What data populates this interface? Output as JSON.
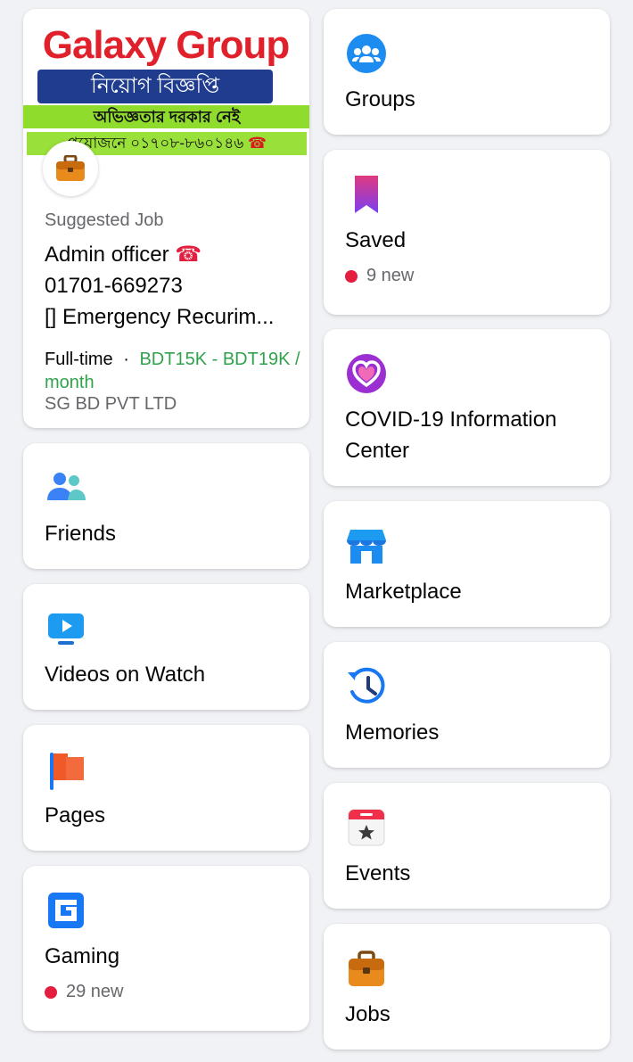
{
  "job_card": {
    "banner": {
      "title": "Galaxy Group",
      "line1": "নিয়োগ বিজ্ঞপ্তি",
      "line2": "অভিজ্ঞতার দরকার নেই",
      "line3": "প্রয়োজনে ০১৭০৮-৮৬০১৪৬",
      "line3_icon": "☎"
    },
    "avatar_icon": "briefcase-icon",
    "subtitle": "Suggested Job",
    "title_line1": "Admin officer",
    "title_icon": "☎",
    "title_line2": "01701-669273",
    "title_line3": "[] Emergency Recurim...",
    "employment_type": "Full-time",
    "separator": "·",
    "salary": "BDT15K - BDT19K / month",
    "company": "SG BD PVT LTD"
  },
  "tiles": {
    "friends": {
      "label": "Friends",
      "icon": "friends-icon"
    },
    "watch": {
      "label": "Videos on Watch",
      "icon": "watch-icon"
    },
    "pages": {
      "label": "Pages",
      "icon": "flag-icon"
    },
    "gaming": {
      "label": "Gaming",
      "icon": "gaming-icon",
      "badge": "29 new"
    },
    "groups": {
      "label": "Groups",
      "icon": "groups-icon"
    },
    "saved": {
      "label": "Saved",
      "icon": "bookmark-icon",
      "badge": "9 new"
    },
    "covid": {
      "label": "COVID-19 Information Center",
      "icon": "heart-icon"
    },
    "marketplace": {
      "label": "Marketplace",
      "icon": "shop-icon"
    },
    "memories": {
      "label": "Memories",
      "icon": "clock-icon"
    },
    "events": {
      "label": "Events",
      "icon": "calendar-icon"
    },
    "jobs": {
      "label": "Jobs",
      "icon": "briefcase-icon"
    }
  },
  "colors": {
    "background": "#f0f2f5",
    "badge_dot": "#e41e3f",
    "salary_green": "#31a24c",
    "blue": "#1877f2"
  }
}
